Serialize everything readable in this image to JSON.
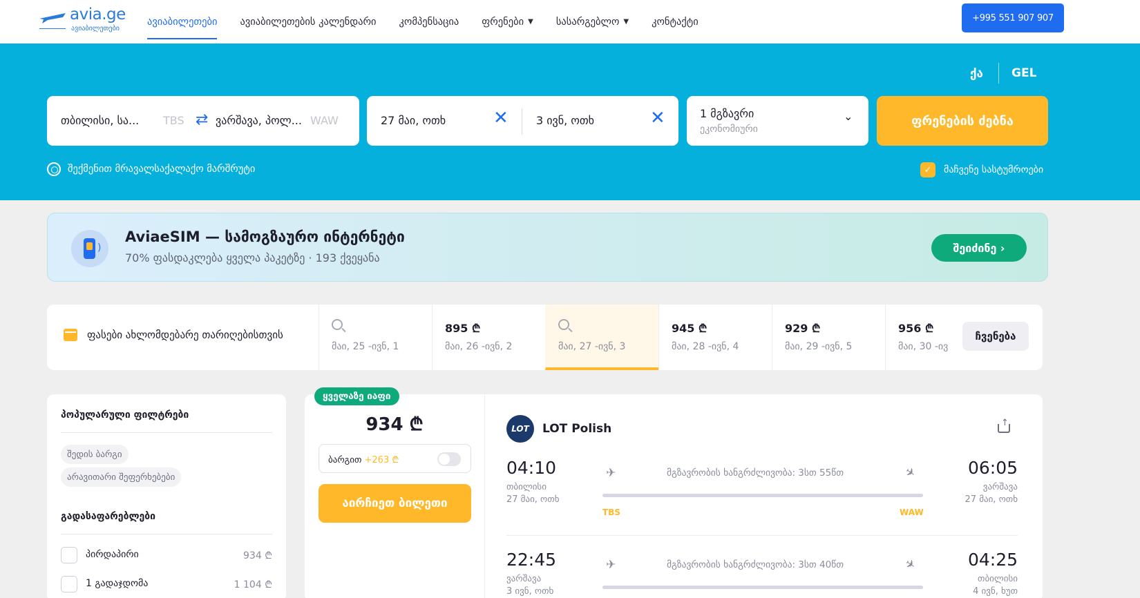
{
  "header": {
    "logo_text": "avia.ge",
    "logo_sub": "ავიაბილეთები",
    "nav": [
      {
        "label": "ავიაბილეთები",
        "active": true
      },
      {
        "label": "ავიაბილეთების კალენდარი"
      },
      {
        "label": "კომპენსაცია"
      },
      {
        "label": "ფრენები",
        "dropdown": true
      },
      {
        "label": "სასარგებლო",
        "dropdown": true
      },
      {
        "label": "კონტაქტი"
      }
    ],
    "phone": "+995 551 907 907"
  },
  "hero": {
    "lang": "ქა",
    "currency": "GEL",
    "from": {
      "city": "თბილისი, სა...",
      "code": "TBS"
    },
    "to": {
      "city": "ვარშავა, პოლ...",
      "code": "WAW"
    },
    "depart_date": "27 მაი, ოთხ",
    "return_date": "3 ივნ, ოთხ",
    "passengers": "1 მგზავრი",
    "cabin": "ეკონომიური",
    "search_label": "ფრენების ძებნა",
    "multi_city_label": "შექმენით მრავალსაქალაქო მარშრუტი",
    "show_hotels_label": "მაჩვენე სასტუმროები",
    "show_hotels_checked": true
  },
  "promo": {
    "title": "AviaeSIM — სამოგზაურო ინტერნეტი",
    "subtitle": "70% ფასდაკლება ყველა პაკეტზე · 193 ქვეყანა",
    "button": "შეიძინე ›"
  },
  "price_strip": {
    "label": "ფასები ახლომდებარე თარიღებისთვის",
    "cells": [
      {
        "price": "",
        "dates": "მაი, 25 -ივნ, 1",
        "searching": true
      },
      {
        "price": "895 ₾",
        "dates": "მაი, 26 -ივნ, 2"
      },
      {
        "price": "",
        "dates": "მაი, 27 -ივნ, 3",
        "searching": true,
        "selected": true
      },
      {
        "price": "945 ₾",
        "dates": "მაი, 28 -ივნ, 4"
      },
      {
        "price": "929 ₾",
        "dates": "მაი, 29 -ივნ, 5"
      },
      {
        "price": "956 ₾",
        "dates": "მაი, 30 -ივ"
      }
    ],
    "show_button": "ჩვენება"
  },
  "filters": {
    "popular_title": "პოპულარული ფილტრები",
    "chips": [
      "შედის ბარგი",
      "არავითარი შეფერხებები"
    ],
    "transfers_title": "გადასაფარებლები",
    "options": [
      {
        "label": "პირდაპირი",
        "price": "934 ₾"
      },
      {
        "label": "1 გადაჯდომა",
        "price": "1 104 ₾"
      }
    ]
  },
  "ticket": {
    "tag": "ყველაზე იაფი",
    "price": "934 ₾",
    "baggage_label": "ბარგით",
    "baggage_extra": "+263 ₾",
    "select_button": "აირჩიეთ ბილეთი",
    "airline_logo": "LOT",
    "airline": "LOT Polish",
    "segments": [
      {
        "dep_time": "04:10",
        "dep_city": "თბილისი",
        "dep_date": "27 მაი, ოთხ",
        "duration": "მგზავრობის ხანგრძლივობა: 3სთ 55წთ",
        "dep_code": "TBS",
        "arr_code": "WAW",
        "arr_time": "06:05",
        "arr_city": "ვარშავა",
        "arr_date": "27 მაი, ოთხ"
      },
      {
        "dep_time": "22:45",
        "dep_city": "ვარშავა",
        "dep_date": "3 ივნ, ოთხ",
        "duration": "მგზავრობის ხანგრძლივობა: 3სთ 40წთ",
        "arr_time": "04:25",
        "arr_city": "თბილისი",
        "arr_date": "4 ივნ, ხუთ"
      }
    ]
  },
  "colors": {
    "brand_blue": "#1f6cf0",
    "hero_bg": "#06b0dd",
    "accent_yellow": "#ffb829",
    "green": "#0faa7b"
  }
}
